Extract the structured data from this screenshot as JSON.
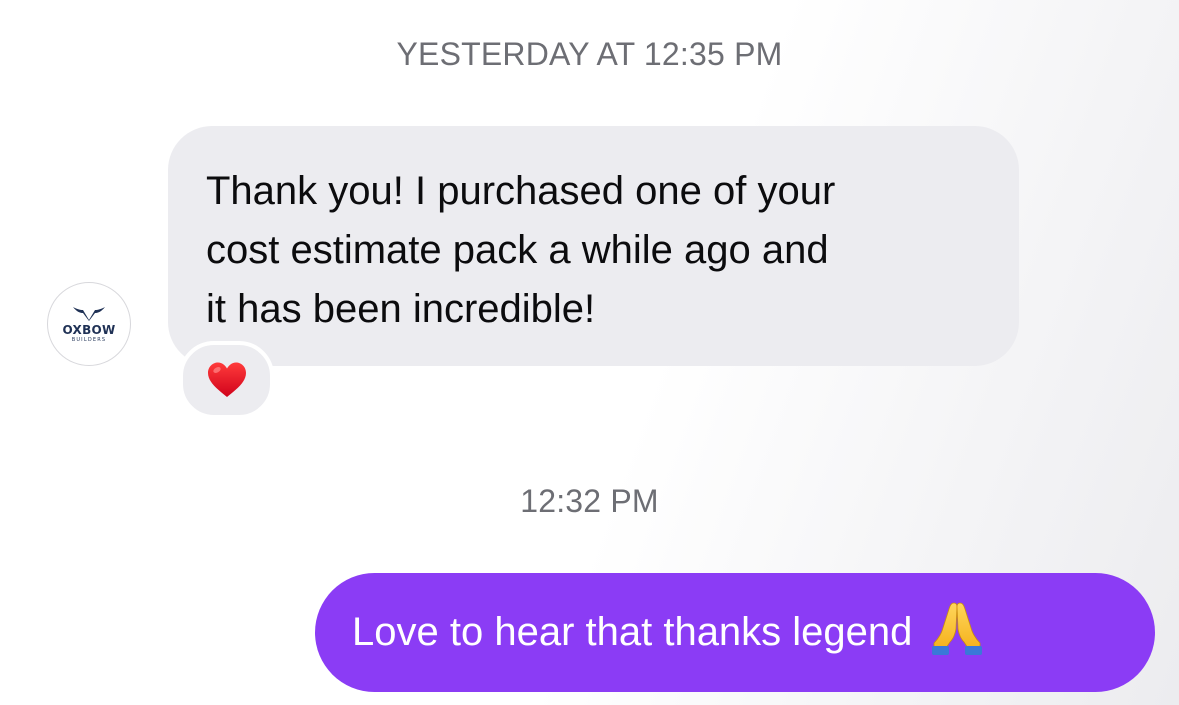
{
  "conversation": {
    "timestamp_top": "YESTERDAY AT 12:35 PM",
    "timestamp_mid": "12:32 PM",
    "incoming": {
      "avatar_brand": "OXBOW",
      "avatar_sub": "BUILDERS",
      "lines": [
        "Thank you! I purchased one of your",
        "cost estimate pack a while ago and",
        "it has been incredible!"
      ],
      "reaction_icon": "red-heart-emoji"
    },
    "outgoing": {
      "text": "Love to hear that thanks legend",
      "emoji_icon": "folded-hands-emoji"
    }
  },
  "colors": {
    "incoming_bubble": "#ececf0",
    "outgoing_bubble": "#8b3cf5",
    "timestamp_text": "#6d6e74"
  }
}
